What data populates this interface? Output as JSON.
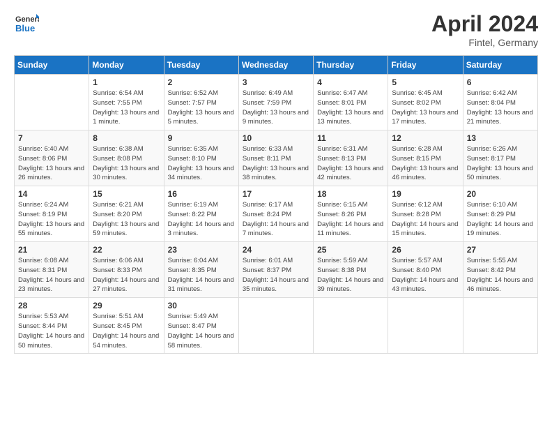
{
  "header": {
    "logo_line1": "General",
    "logo_line2": "Blue",
    "month_title": "April 2024",
    "location": "Fintel, Germany"
  },
  "days_of_week": [
    "Sunday",
    "Monday",
    "Tuesday",
    "Wednesday",
    "Thursday",
    "Friday",
    "Saturday"
  ],
  "weeks": [
    [
      {
        "day": "",
        "sunrise": "",
        "sunset": "",
        "daylight": ""
      },
      {
        "day": "1",
        "sunrise": "Sunrise: 6:54 AM",
        "sunset": "Sunset: 7:55 PM",
        "daylight": "Daylight: 13 hours and 1 minute."
      },
      {
        "day": "2",
        "sunrise": "Sunrise: 6:52 AM",
        "sunset": "Sunset: 7:57 PM",
        "daylight": "Daylight: 13 hours and 5 minutes."
      },
      {
        "day": "3",
        "sunrise": "Sunrise: 6:49 AM",
        "sunset": "Sunset: 7:59 PM",
        "daylight": "Daylight: 13 hours and 9 minutes."
      },
      {
        "day": "4",
        "sunrise": "Sunrise: 6:47 AM",
        "sunset": "Sunset: 8:01 PM",
        "daylight": "Daylight: 13 hours and 13 minutes."
      },
      {
        "day": "5",
        "sunrise": "Sunrise: 6:45 AM",
        "sunset": "Sunset: 8:02 PM",
        "daylight": "Daylight: 13 hours and 17 minutes."
      },
      {
        "day": "6",
        "sunrise": "Sunrise: 6:42 AM",
        "sunset": "Sunset: 8:04 PM",
        "daylight": "Daylight: 13 hours and 21 minutes."
      }
    ],
    [
      {
        "day": "7",
        "sunrise": "Sunrise: 6:40 AM",
        "sunset": "Sunset: 8:06 PM",
        "daylight": "Daylight: 13 hours and 26 minutes."
      },
      {
        "day": "8",
        "sunrise": "Sunrise: 6:38 AM",
        "sunset": "Sunset: 8:08 PM",
        "daylight": "Daylight: 13 hours and 30 minutes."
      },
      {
        "day": "9",
        "sunrise": "Sunrise: 6:35 AM",
        "sunset": "Sunset: 8:10 PM",
        "daylight": "Daylight: 13 hours and 34 minutes."
      },
      {
        "day": "10",
        "sunrise": "Sunrise: 6:33 AM",
        "sunset": "Sunset: 8:11 PM",
        "daylight": "Daylight: 13 hours and 38 minutes."
      },
      {
        "day": "11",
        "sunrise": "Sunrise: 6:31 AM",
        "sunset": "Sunset: 8:13 PM",
        "daylight": "Daylight: 13 hours and 42 minutes."
      },
      {
        "day": "12",
        "sunrise": "Sunrise: 6:28 AM",
        "sunset": "Sunset: 8:15 PM",
        "daylight": "Daylight: 13 hours and 46 minutes."
      },
      {
        "day": "13",
        "sunrise": "Sunrise: 6:26 AM",
        "sunset": "Sunset: 8:17 PM",
        "daylight": "Daylight: 13 hours and 50 minutes."
      }
    ],
    [
      {
        "day": "14",
        "sunrise": "Sunrise: 6:24 AM",
        "sunset": "Sunset: 8:19 PM",
        "daylight": "Daylight: 13 hours and 55 minutes."
      },
      {
        "day": "15",
        "sunrise": "Sunrise: 6:21 AM",
        "sunset": "Sunset: 8:20 PM",
        "daylight": "Daylight: 13 hours and 59 minutes."
      },
      {
        "day": "16",
        "sunrise": "Sunrise: 6:19 AM",
        "sunset": "Sunset: 8:22 PM",
        "daylight": "Daylight: 14 hours and 3 minutes."
      },
      {
        "day": "17",
        "sunrise": "Sunrise: 6:17 AM",
        "sunset": "Sunset: 8:24 PM",
        "daylight": "Daylight: 14 hours and 7 minutes."
      },
      {
        "day": "18",
        "sunrise": "Sunrise: 6:15 AM",
        "sunset": "Sunset: 8:26 PM",
        "daylight": "Daylight: 14 hours and 11 minutes."
      },
      {
        "day": "19",
        "sunrise": "Sunrise: 6:12 AM",
        "sunset": "Sunset: 8:28 PM",
        "daylight": "Daylight: 14 hours and 15 minutes."
      },
      {
        "day": "20",
        "sunrise": "Sunrise: 6:10 AM",
        "sunset": "Sunset: 8:29 PM",
        "daylight": "Daylight: 14 hours and 19 minutes."
      }
    ],
    [
      {
        "day": "21",
        "sunrise": "Sunrise: 6:08 AM",
        "sunset": "Sunset: 8:31 PM",
        "daylight": "Daylight: 14 hours and 23 minutes."
      },
      {
        "day": "22",
        "sunrise": "Sunrise: 6:06 AM",
        "sunset": "Sunset: 8:33 PM",
        "daylight": "Daylight: 14 hours and 27 minutes."
      },
      {
        "day": "23",
        "sunrise": "Sunrise: 6:04 AM",
        "sunset": "Sunset: 8:35 PM",
        "daylight": "Daylight: 14 hours and 31 minutes."
      },
      {
        "day": "24",
        "sunrise": "Sunrise: 6:01 AM",
        "sunset": "Sunset: 8:37 PM",
        "daylight": "Daylight: 14 hours and 35 minutes."
      },
      {
        "day": "25",
        "sunrise": "Sunrise: 5:59 AM",
        "sunset": "Sunset: 8:38 PM",
        "daylight": "Daylight: 14 hours and 39 minutes."
      },
      {
        "day": "26",
        "sunrise": "Sunrise: 5:57 AM",
        "sunset": "Sunset: 8:40 PM",
        "daylight": "Daylight: 14 hours and 43 minutes."
      },
      {
        "day": "27",
        "sunrise": "Sunrise: 5:55 AM",
        "sunset": "Sunset: 8:42 PM",
        "daylight": "Daylight: 14 hours and 46 minutes."
      }
    ],
    [
      {
        "day": "28",
        "sunrise": "Sunrise: 5:53 AM",
        "sunset": "Sunset: 8:44 PM",
        "daylight": "Daylight: 14 hours and 50 minutes."
      },
      {
        "day": "29",
        "sunrise": "Sunrise: 5:51 AM",
        "sunset": "Sunset: 8:45 PM",
        "daylight": "Daylight: 14 hours and 54 minutes."
      },
      {
        "day": "30",
        "sunrise": "Sunrise: 5:49 AM",
        "sunset": "Sunset: 8:47 PM",
        "daylight": "Daylight: 14 hours and 58 minutes."
      },
      {
        "day": "",
        "sunrise": "",
        "sunset": "",
        "daylight": ""
      },
      {
        "day": "",
        "sunrise": "",
        "sunset": "",
        "daylight": ""
      },
      {
        "day": "",
        "sunrise": "",
        "sunset": "",
        "daylight": ""
      },
      {
        "day": "",
        "sunrise": "",
        "sunset": "",
        "daylight": ""
      }
    ]
  ]
}
